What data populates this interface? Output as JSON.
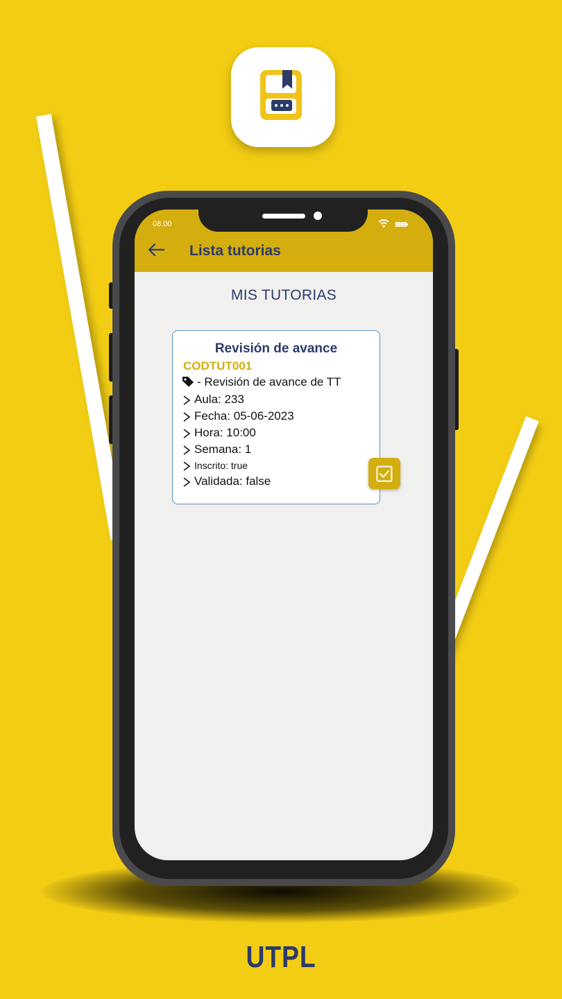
{
  "status_bar": {
    "time": "08.00",
    "icons": [
      "wifi-icon",
      "battery-icon"
    ]
  },
  "app_bar": {
    "back_icon": "arrow-left-icon",
    "title": "Lista tutorias"
  },
  "section_title": "MIS TUTORIAS",
  "tutoria_card": {
    "title": "Revisión de avance",
    "code": "CODTUT001",
    "description": "- Revisión de avance de TT",
    "aula": "Aula: 233",
    "fecha": "Fecha: 05-06-2023",
    "hora": "Hora: 10:00",
    "semana": "Semana: 1",
    "inscrito": "Inscrito: true",
    "validada": "Validada: false",
    "action_icon": "checkbox-checked-icon"
  },
  "brand": "UTPL",
  "colors": {
    "background": "#f2cd14",
    "app_bar": "#d4ad0f",
    "title_text": "#2b3a6b",
    "code_text": "#d4ad0f",
    "card_border": "#5a93c8",
    "screen": "#f0f0ee"
  }
}
